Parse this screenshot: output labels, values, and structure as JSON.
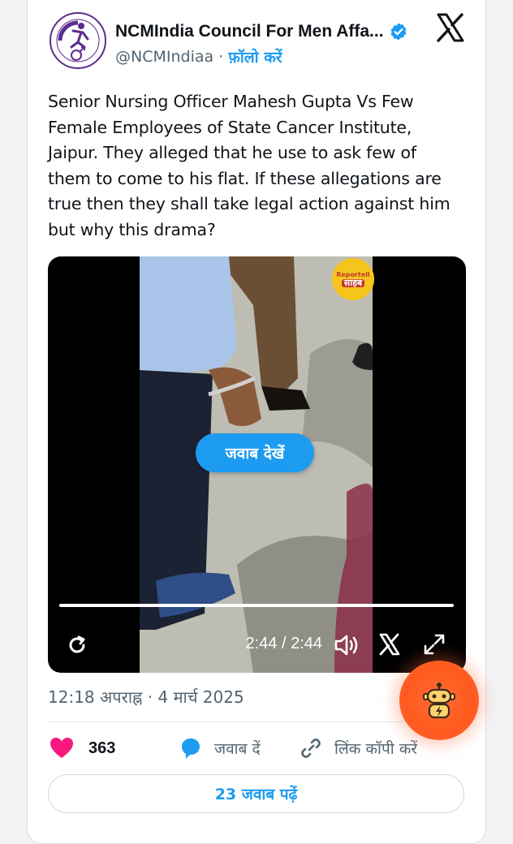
{
  "tweet": {
    "display_name": "NCMIndia Council For Men Affa...",
    "handle": "@NCMIndiaa",
    "separator": "·",
    "follow_label": "फ़ॉलो करें",
    "text": "Senior Nursing Officer Mahesh Gupta Vs Few Female Employees of State Cancer Institute, Jaipur. They alleged that he use to ask few of them to come to his flat. If these allegations are true then they shall take legal action against him but why this drama?",
    "timestamp": "12:18 अपराह्न · 4 मार्च 2025"
  },
  "video": {
    "reply_pill_label": "जवाब देखें",
    "time_display": "2:44 / 2:44",
    "progress_fraction": 1.0,
    "watermark_top": "Reportell",
    "watermark_bottom": "साहब"
  },
  "actions": {
    "likes_count": "363",
    "reply_label": "जवाब दें",
    "copy_link_label": "लिंक कॉपी करें"
  },
  "read_replies_label": "23 जवाब पढ़ें",
  "icons": {
    "verified": "verified-badge-icon",
    "x_logo": "x-logo-icon",
    "replay": "replay-icon",
    "volume": "volume-icon",
    "fullscreen": "fullscreen-icon",
    "heart": "heart-icon",
    "reply": "reply-bubble-icon",
    "link": "link-icon",
    "assistant": "robot-assistant-icon"
  },
  "colors": {
    "accent": "#1d9bf0",
    "heart": "#f91880",
    "fab": "#ff5a1f"
  }
}
